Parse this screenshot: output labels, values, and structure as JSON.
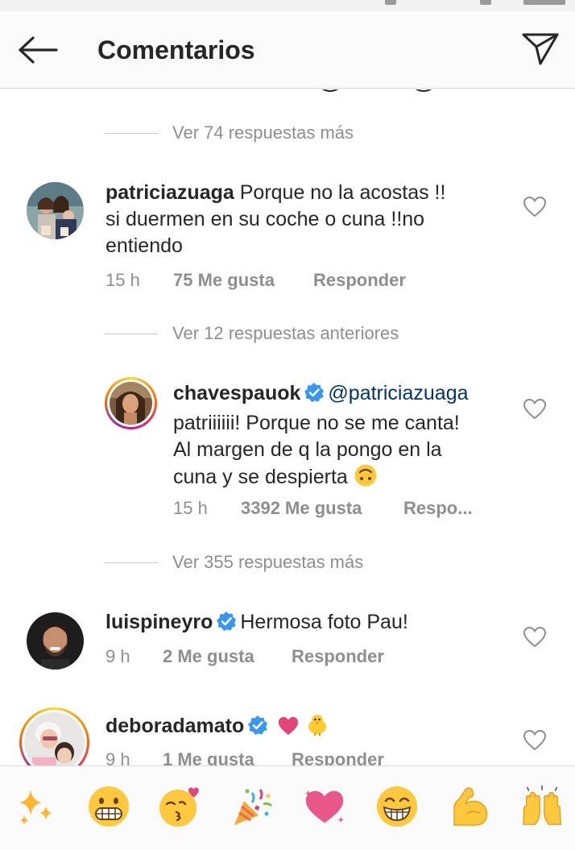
{
  "header": {
    "title": "Comentarios"
  },
  "threads": [
    {
      "more_label": "Ver 74 respuestas más"
    }
  ],
  "comments": [
    {
      "username": "patriciazuaga",
      "text_line1": "Porque no la acostas !!",
      "text_line2": "si duermen en su coche o cuna !!no",
      "text_line3": "entiendo",
      "time": "15 h",
      "likes": "75 Me gusta",
      "reply": "Responder"
    },
    {
      "username": "chavespauok",
      "mention": "@patriciazuaga",
      "text_line1": "patriiiiii! Porque no se me canta!",
      "text_line2": "Al margen de q la pongo en la",
      "text_line3": "cuna y se despierta",
      "time": "15 h",
      "likes": "3392 Me gusta",
      "reply": "Respo..."
    },
    {
      "username": "luispineyro",
      "text_line1": "Hermosa foto Pau!",
      "time": "9 h",
      "likes": "2 Me gusta",
      "reply": "Responder"
    },
    {
      "username": "deboradamato",
      "time": "9 h",
      "likes": "1 Me gusta",
      "reply": "Responder"
    }
  ],
  "view_more": {
    "previous_replies": "Ver 12 respuestas anteriores",
    "more_355": "Ver 355 respuestas más"
  },
  "emoji_bar": {
    "items": [
      "sparkles-emoji",
      "grimacing-face-emoji",
      "kissing-face-emoji",
      "party-popper-emoji",
      "heart-emoji",
      "grinning-face-emoji",
      "flexed-biceps-emoji",
      "raising-hands-emoji"
    ]
  },
  "colors": {
    "verified_blue": "#3897f0",
    "mention_blue": "#003569",
    "meta_gray": "#8e8e8e",
    "text_dark": "#262626"
  }
}
